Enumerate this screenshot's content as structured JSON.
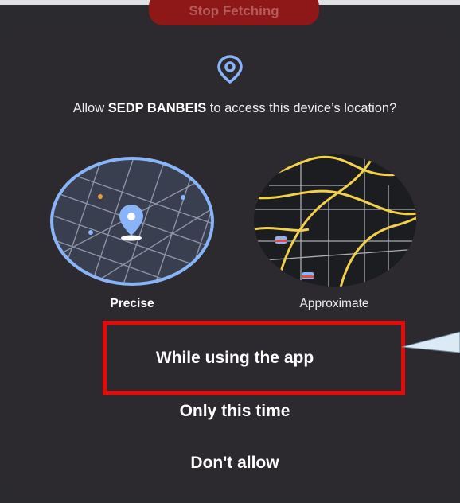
{
  "background": {
    "button_label": "Stop Fetching"
  },
  "dialog": {
    "icon": "location-pin-icon",
    "title_prefix": "Allow ",
    "app_name": "SEDP BANBEIS",
    "title_suffix": " to access this device’s location?",
    "options": {
      "precise_label": "Precise",
      "approximate_label": "Approximate",
      "selected": "Precise"
    },
    "actions": {
      "while_using": "While using the app",
      "only_this_time": "Only this time",
      "dont_allow": "Don't allow"
    }
  },
  "annotation": {
    "highlight_target": "While using the app",
    "highlight_color": "#e50b0b"
  },
  "colors": {
    "accent": "#8ab4f8",
    "dialog_bg": "#2c2a2f",
    "road_yellow": "#f2d04b"
  }
}
